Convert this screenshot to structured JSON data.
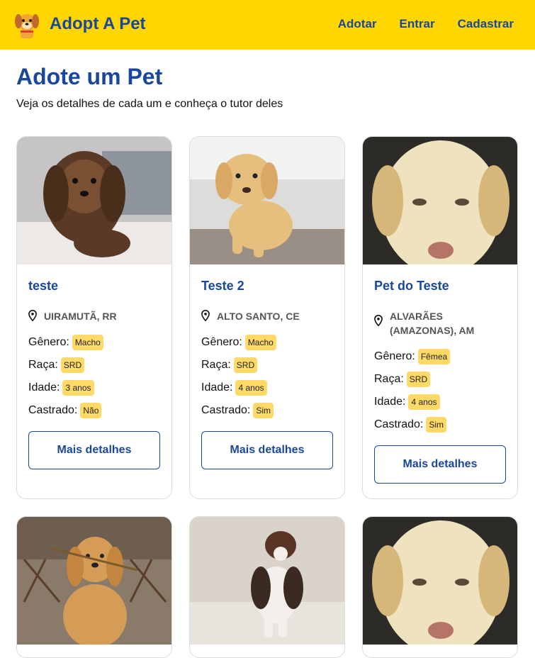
{
  "header": {
    "brand": "Adopt A Pet",
    "nav": [
      "Adotar",
      "Entrar",
      "Cadastrar"
    ],
    "logo_icon": "dog-logo-icon",
    "color_bar": "#FFD600",
    "color_text": "#1A479E"
  },
  "page": {
    "title": "Adote um Pet",
    "subtitle": "Veja os detalhes de cada um e conheça o tutor deles"
  },
  "labels": {
    "gender": "Gênero:",
    "breed": "Raça:",
    "age": "Idade:",
    "neutered": "Castrado:",
    "details_button": "Mais detalhes"
  },
  "pets": [
    {
      "name": "teste",
      "location": "UIRAMUTÃ, RR",
      "gender": "Macho",
      "breed": "SRD",
      "age": "3 anos",
      "neutered": "Não"
    },
    {
      "name": "Teste 2",
      "location": "ALTO SANTO, CE",
      "gender": "Macho",
      "breed": "SRD",
      "age": "4 anos",
      "neutered": "Sim"
    },
    {
      "name": "Pet do Teste",
      "location": "ALVARÃES (AMAZONAS), AM",
      "gender": "Fêmea",
      "breed": "SRD",
      "age": "4 anos",
      "neutered": "Sim"
    }
  ]
}
